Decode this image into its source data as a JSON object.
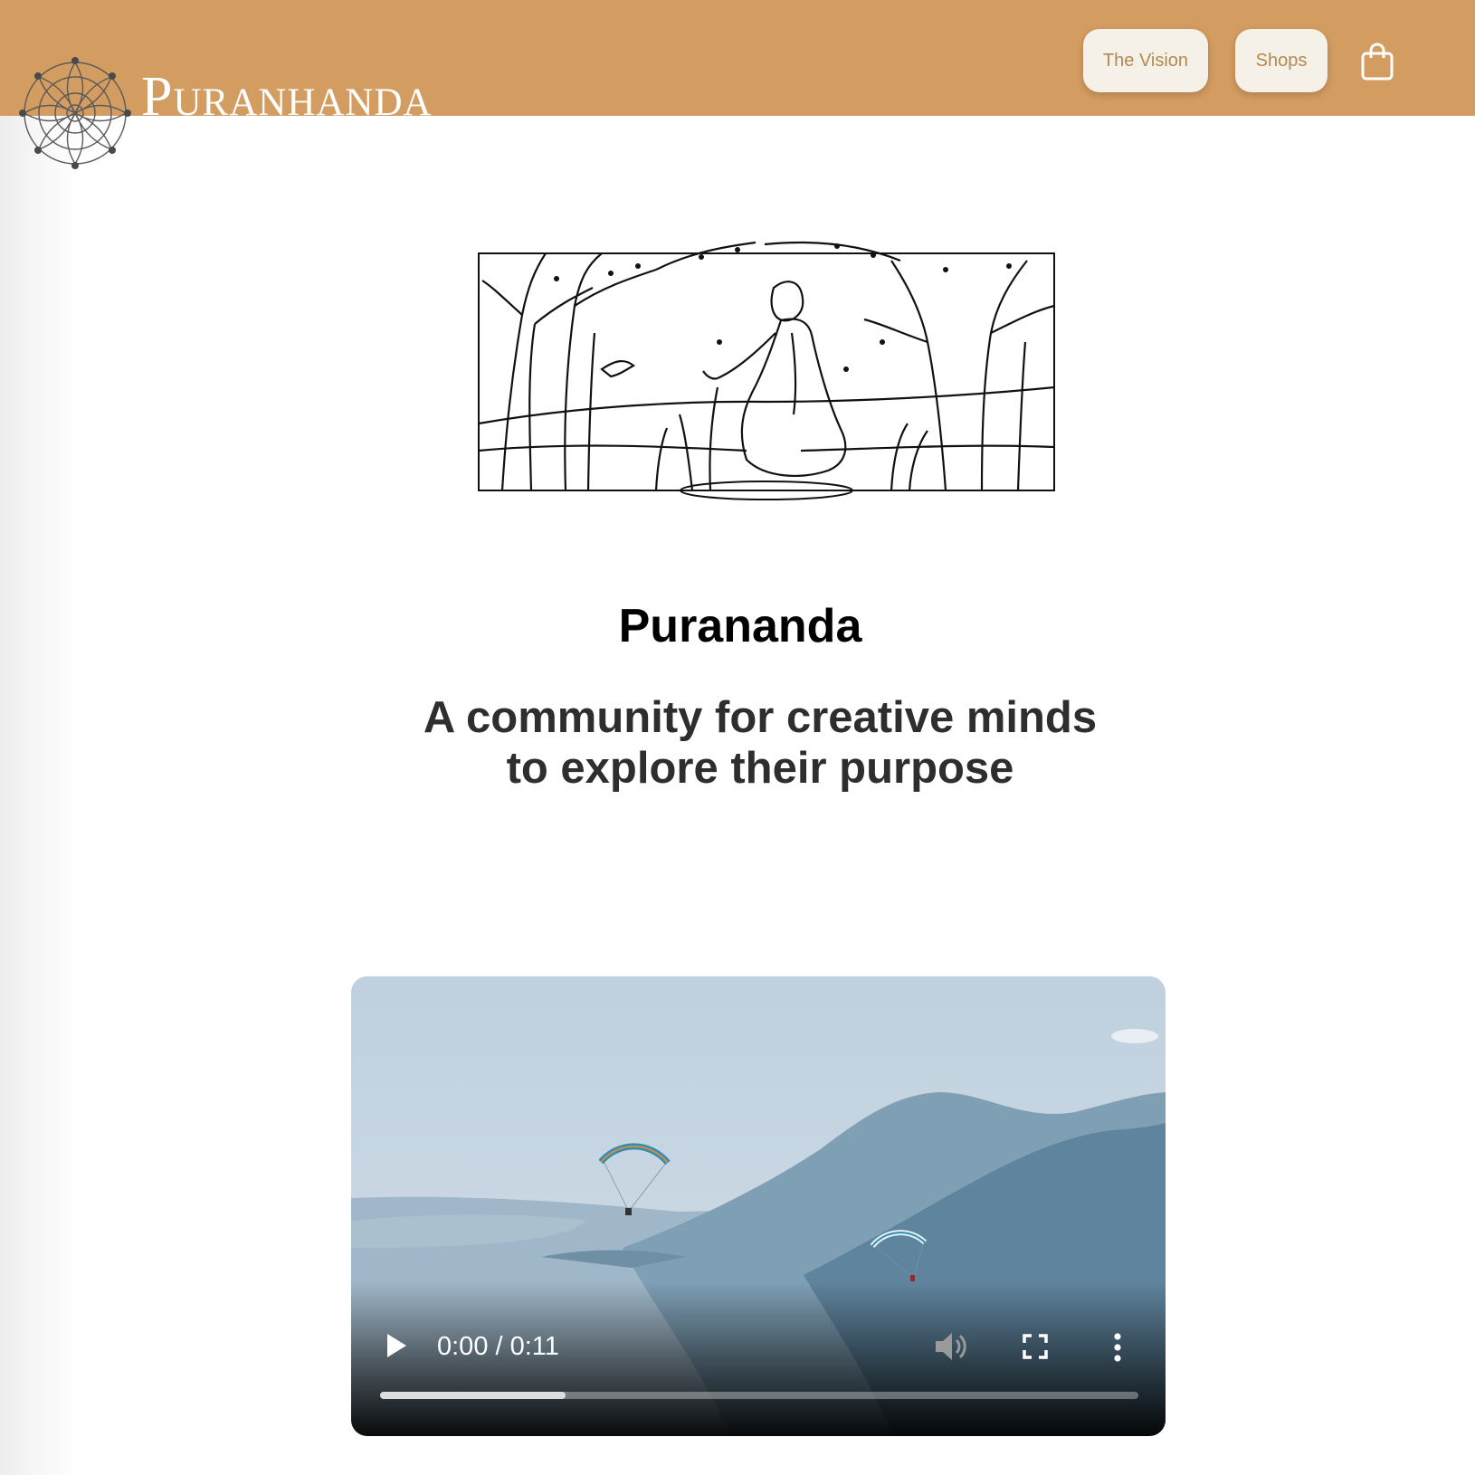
{
  "header": {
    "brand": "Puranhanda",
    "nav": [
      {
        "label": "The Vision"
      },
      {
        "label": "Shops"
      }
    ],
    "cart_icon": "shopping-bag-icon",
    "background": "#d39c60"
  },
  "hero": {
    "title": "Purananda",
    "tagline_line1": "A community for creative minds",
    "tagline_line2": "to explore their purpose"
  },
  "video": {
    "time": "0:00 / 0:11",
    "buffered_fraction": 0.245,
    "icons": [
      "play-icon",
      "volume-icon",
      "fullscreen-icon",
      "more-options-icon"
    ]
  }
}
